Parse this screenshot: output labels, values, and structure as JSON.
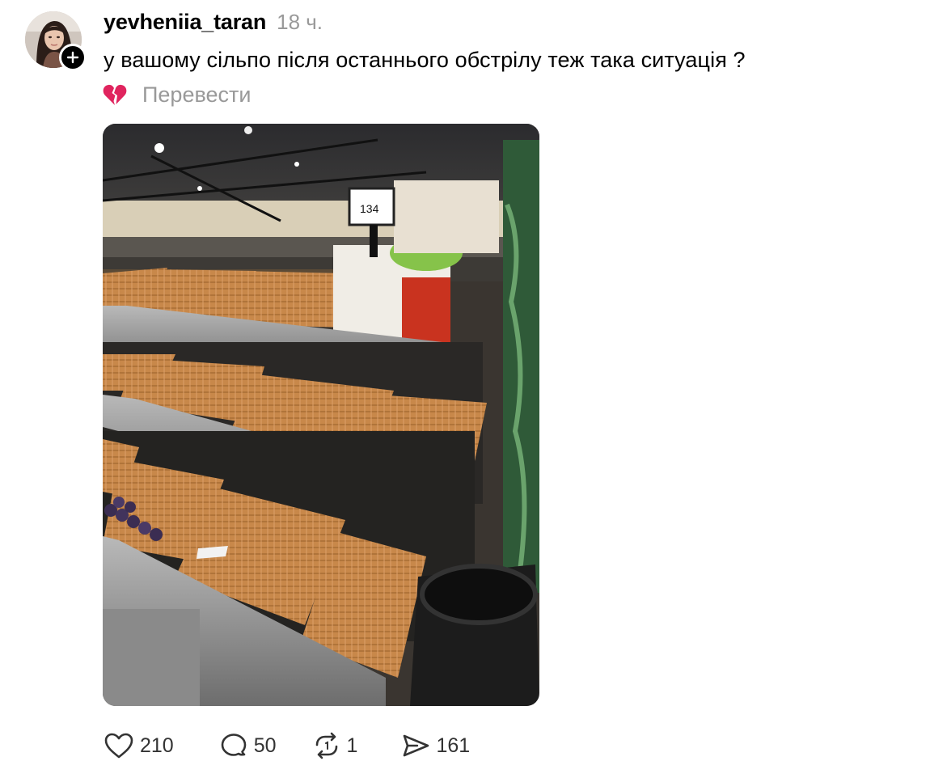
{
  "post": {
    "username": "yevheniia_taran",
    "timestamp": "18 ч.",
    "text": "у вашому сільпо після останнього обстрілу теж така ситуація ?",
    "emoji": "💔",
    "translate_label": "Перевести",
    "photo_price_tag": "134"
  },
  "actions": {
    "likes": "210",
    "comments": "50",
    "reposts": "1",
    "shares": "161"
  },
  "icons": {
    "like": "heart-icon",
    "comment": "speech-bubble-icon",
    "repost": "repost-arrows-icon",
    "share": "send-arrow-icon",
    "follow": "plus-icon"
  },
  "colors": {
    "text": "#000000",
    "secondary_text": "#999999",
    "counts": "#333333",
    "emoji": "#e0245e"
  }
}
